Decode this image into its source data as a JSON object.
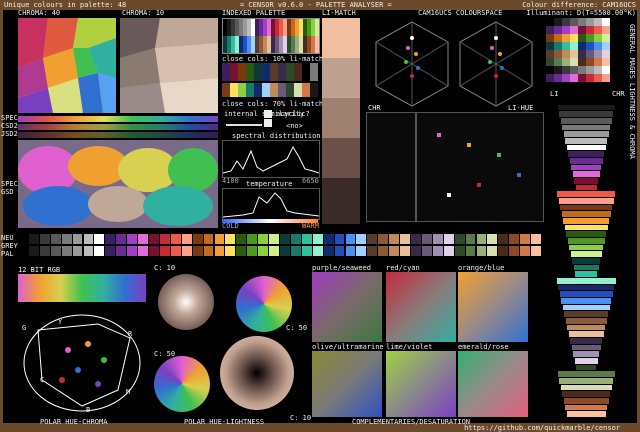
{
  "header": {
    "unique_colours": "Unique colours in palette: 48",
    "title": "= CENSOR v0.6.0 - PALETTE ANALYSER =",
    "colour_difference": "Colour difference: CAM16UCS",
    "illuminant": "Illuminant: D(T=5500.00°K)"
  },
  "labels": {
    "chroma40": "CHROMA: 40",
    "chroma10": "CHROMA: 10",
    "indexed_palette": "INDEXED PALETTE",
    "li_match": "LI-MATCH",
    "cam16_space": "CAM16UCS COLOURSPACE",
    "close_cols_10": "close cols: 10% li-match",
    "close_cols_70": "close cols: 70% li-match",
    "internal_similarity": "internal similarity",
    "cyclic": "acyclic?",
    "cyclic_value": "<no>",
    "spectral_distribution": "spectral distribution",
    "spectral_min": "4100",
    "spectral_max": "6650",
    "temperature": "temperature",
    "cold": "COLD",
    "warm": "WARM",
    "chr": "CHR",
    "li_hue": "LI-HUE",
    "li": "LI",
    "chr_right": "CHR",
    "spec": "SPEC",
    "csd2": "CSD2",
    "jsd2": "JSD2",
    "spec2": "SPEC",
    "gsd": "GSD",
    "neu": "NEU",
    "grey": "GREY",
    "pal": "PAL",
    "bit12": "12 BIT RGB",
    "c10a": "C: 10",
    "c50a": "C: 50",
    "c50b": "C: 50",
    "c10b": "C: 10",
    "purple_seaweed": "purple/seaweed",
    "red_cyan": "red/cyan",
    "orange_blue": "orange/blue",
    "olive_ultramarine": "olive/ultramarine",
    "lime_violet": "lime/violet",
    "emerald_rose": "emerald/rose",
    "polar_hue_chroma": "POLAR HUE-CHROMA",
    "polar_hue_lightness": "POLAR HUE-LIGHTNESS",
    "complementaries": "COMPLEMENTARIES/DESATURATION",
    "github": "https://github.com/quickmarble/censor",
    "side_text": "GENERAL MAGES  LIGHTNESS & CHROMA",
    "hue_r": "R",
    "hue_y": "Y",
    "hue_g": "G",
    "hue_c": "C",
    "hue_b": "B",
    "hue_m": "M"
  },
  "palette": [
    "#000000",
    "#1a1a1a",
    "#3a3a3a",
    "#5a5a5a",
    "#7a7a7a",
    "#9a9a9a",
    "#bcbcbc",
    "#ffffff",
    "#3b1f5e",
    "#6a2c91",
    "#a33fc4",
    "#e36bd9",
    "#7a1030",
    "#c42a3a",
    "#f05a4a",
    "#ffa08a",
    "#7a3a10",
    "#c46a20",
    "#f0a030",
    "#ffe060",
    "#2a5a10",
    "#4a9a20",
    "#8ad040",
    "#d0f090",
    "#0a3a3a",
    "#1a7a6a",
    "#30c0a0",
    "#90f0d0",
    "#102a6a",
    "#2050c0",
    "#4a90f0",
    "#a0d0ff",
    "#5a3a2a",
    "#8a5a3a",
    "#c08a5a",
    "#e8c09a",
    "#3a2a4a",
    "#6a5a7a",
    "#a090b0",
    "#e0d0e8",
    "#2a4a2a",
    "#5a7a4a",
    "#9ab07a",
    "#d8e0b0",
    "#4a2a1a",
    "#8a4a2a",
    "#d07a4a",
    "#f8c0a0"
  ],
  "menu": {
    "left_arrow": "◄",
    "right_arrow": "►"
  }
}
